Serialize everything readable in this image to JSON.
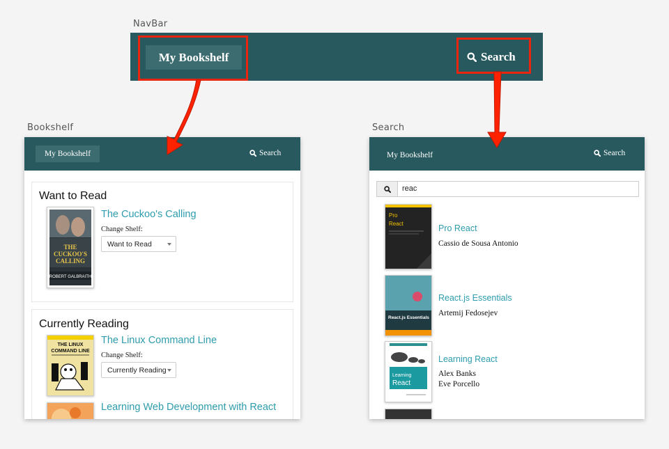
{
  "labels": {
    "navbar": "NavBar",
    "bookshelf": "Bookshelf",
    "search": "Search"
  },
  "colors": {
    "navbar_teal": "#27595e",
    "highlight_red": "#e8250f",
    "link_teal": "#2e9cad"
  },
  "navbar": {
    "brand": "My Bookshelf",
    "search_label": "Search",
    "search_icon": "magnifier-icon"
  },
  "bookshelf_view": {
    "nav": {
      "brand": "My Bookshelf",
      "search_label": "Search"
    },
    "shelves": [
      {
        "title": "Want to Read",
        "books": [
          {
            "title": "The Cuckoo's Calling",
            "change_label": "Change Shelf:",
            "selected": "Want to Read"
          }
        ]
      },
      {
        "title": "Currently Reading",
        "books": [
          {
            "title": "The Linux Command Line",
            "change_label": "Change Shelf:",
            "selected": "Currently Reading"
          },
          {
            "title": "Learning Web Development with React"
          }
        ]
      }
    ]
  },
  "search_view": {
    "nav": {
      "brand": "My Bookshelf",
      "search_label": "Search"
    },
    "query": "reac",
    "results": [
      {
        "title": "Pro React",
        "authors": [
          "Cassio de Sousa Antonio"
        ]
      },
      {
        "title": "React.js Essentials",
        "authors": [
          "Artemij Fedosejev"
        ]
      },
      {
        "title": "Learning React",
        "authors": [
          "Alex Banks",
          "Eve Porcello"
        ]
      }
    ]
  }
}
